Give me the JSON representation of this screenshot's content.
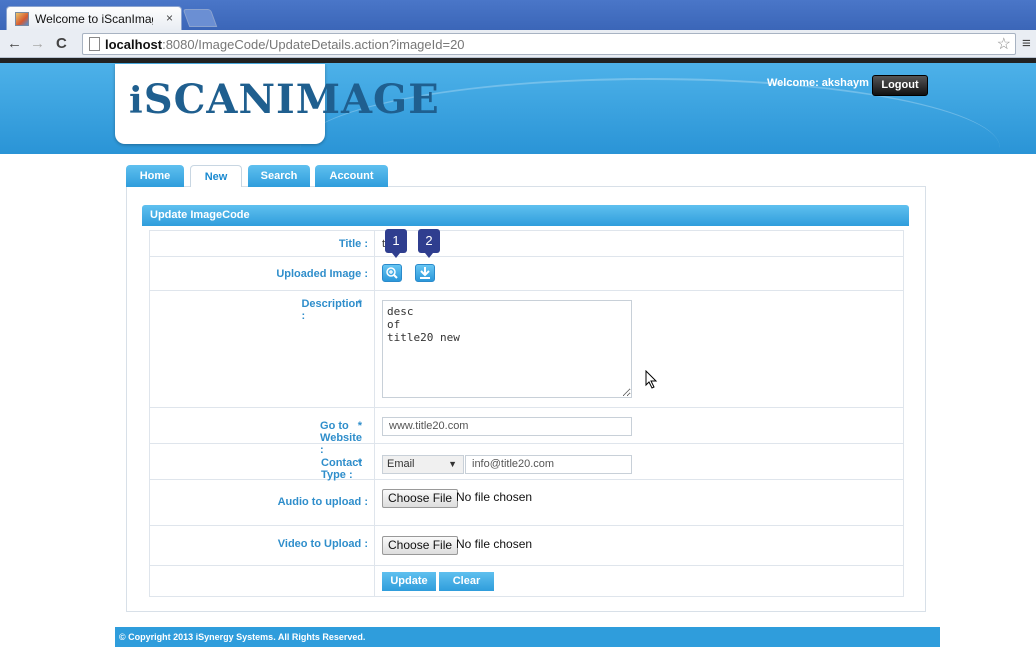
{
  "browser": {
    "tab_title": "Welcome to iScanImag",
    "tab_close": "×",
    "url_host": "localhost",
    "url_rest": ":8080/ImageCode/UpdateDetails.action?imageId=20"
  },
  "header": {
    "logo_i": "i",
    "logo_text": "SCANIMAGE",
    "welcome": "Welcome: akshaym",
    "logout": "Logout"
  },
  "nav": {
    "tabs": [
      "Home",
      "New",
      "Search",
      "Account"
    ],
    "active": "New"
  },
  "panel": {
    "title": "Update ImageCode"
  },
  "form": {
    "title_label": "Title :",
    "title_value": "t",
    "image_label": "Uploaded Image :",
    "badges": [
      "1",
      "2"
    ],
    "desc_req": "*",
    "desc_label": " Description :",
    "desc_value": "desc\nof\ntitle20 new",
    "website_req": "*",
    "website_label": " Go to Website :",
    "website_value": "www.title20.com",
    "contact_req": "*",
    "contact_label": " Contact Type :",
    "contact_type": "Email",
    "contact_value": "info@title20.com",
    "audio_label": "Audio to upload :",
    "video_label": "Video to Upload :",
    "choose_file": "Choose File",
    "no_file": "No file chosen",
    "update": "Update",
    "clear": "Clear"
  },
  "footer": {
    "text": "© Copyright 2013 iSynergy Systems. All Rights Reserved."
  },
  "colors": {
    "accent": "#2f9ddc",
    "label": "#2f8ecb",
    "required": "#e02020",
    "badge": "#2f3e8f"
  }
}
